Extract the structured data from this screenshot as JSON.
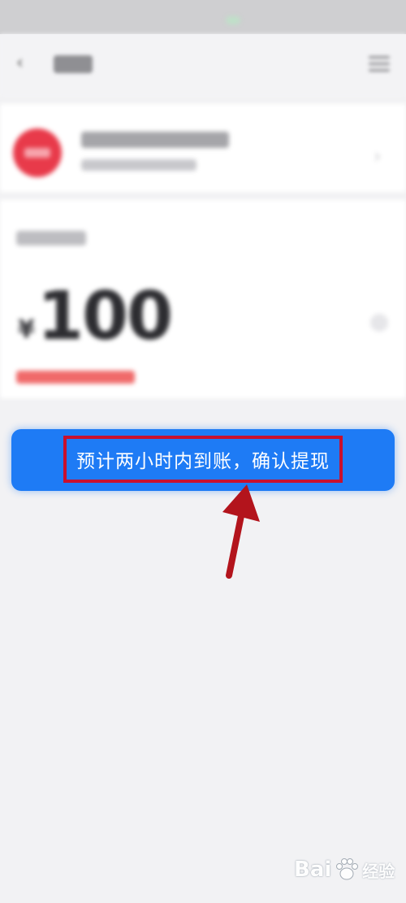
{
  "header": {
    "back_icon": "arrow-left-icon",
    "menu_icon": "menu-icon"
  },
  "amount": {
    "currency": "¥",
    "value": "100"
  },
  "confirm_button": {
    "label": "预计两小时内到账，确认提现",
    "color": "#1e7bf5",
    "annotation_color": "#c8102e"
  },
  "watermark": {
    "brand": "Bai",
    "suffix": "经验"
  }
}
